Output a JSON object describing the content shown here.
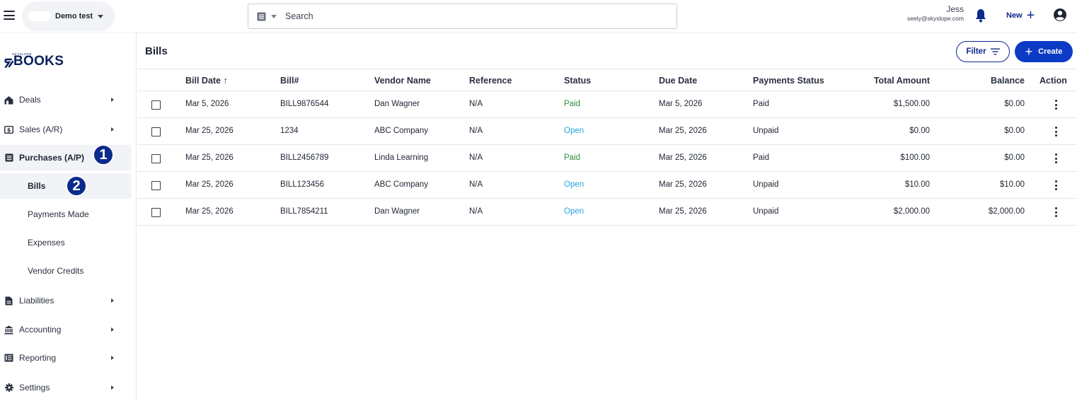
{
  "header": {
    "account_name": "Demo test",
    "search_placeholder": "Search",
    "user_name": "Jess",
    "user_email": "seely@skyslope.com",
    "new_label": "New"
  },
  "logo": {
    "brand_small": "SKYSLOPE",
    "brand_text": "BOOKS"
  },
  "sidebar": {
    "items": [
      {
        "label": "Deals",
        "icon": "deals-icon"
      },
      {
        "label": "Sales (A/R)",
        "icon": "sales-icon"
      },
      {
        "label": "Purchases (A/P)",
        "icon": "purchases-icon"
      },
      {
        "label": "Liabilities",
        "icon": "liabilities-icon"
      },
      {
        "label": "Accounting",
        "icon": "accounting-icon"
      },
      {
        "label": "Reporting",
        "icon": "reporting-icon"
      },
      {
        "label": "Settings",
        "icon": "settings-icon"
      }
    ],
    "purchases_sub": [
      "Bills",
      "Payments Made",
      "Expenses",
      "Vendor Credits"
    ]
  },
  "badges": [
    "1",
    "2"
  ],
  "main": {
    "title": "Bills",
    "filter_label": "Filter",
    "create_label": "Create"
  },
  "table": {
    "headers": [
      "Bill Date ↑",
      "Bill#",
      "Vendor Name",
      "Reference",
      "Status",
      "Due Date",
      "Payments Status",
      "Total Amount",
      "Balance",
      "Action"
    ],
    "rows": [
      {
        "bill_date": "Mar 5, 2026",
        "bill_no": "BILL9876544",
        "vendor": "Dan Wagner",
        "reference": "N/A",
        "status": "Paid",
        "due_date": "Mar 5, 2026",
        "payment_status": "Paid",
        "total": "$1,500.00",
        "balance": "$0.00"
      },
      {
        "bill_date": "Mar 25, 2026",
        "bill_no": "1234",
        "vendor": "ABC Company",
        "reference": "N/A",
        "status": "Open",
        "due_date": "Mar 25, 2026",
        "payment_status": "Unpaid",
        "total": "$0.00",
        "balance": "$0.00"
      },
      {
        "bill_date": "Mar 25, 2026",
        "bill_no": "BILL2456789",
        "vendor": "Linda Learning",
        "reference": "N/A",
        "status": "Paid",
        "due_date": "Mar 25, 2026",
        "payment_status": "Paid",
        "total": "$100.00",
        "balance": "$0.00"
      },
      {
        "bill_date": "Mar 25, 2026",
        "bill_no": "BILL123456",
        "vendor": "ABC Company",
        "reference": "N/A",
        "status": "Open",
        "due_date": "Mar 25, 2026",
        "payment_status": "Unpaid",
        "total": "$10.00",
        "balance": "$10.00"
      },
      {
        "bill_date": "Mar 25, 2026",
        "bill_no": "BILL7854211",
        "vendor": "Dan Wagner",
        "reference": "N/A",
        "status": "Open",
        "due_date": "Mar 25, 2026",
        "payment_status": "Unpaid",
        "total": "$2,000.00",
        "balance": "$2,000.00"
      }
    ]
  },
  "colors": {
    "brand_navy": "#0b2a8c",
    "create_blue": "#0b3bc4",
    "status_paid": "#2e8b3a",
    "status_open": "#29a3df",
    "active_bg": "#f1f3f6"
  }
}
